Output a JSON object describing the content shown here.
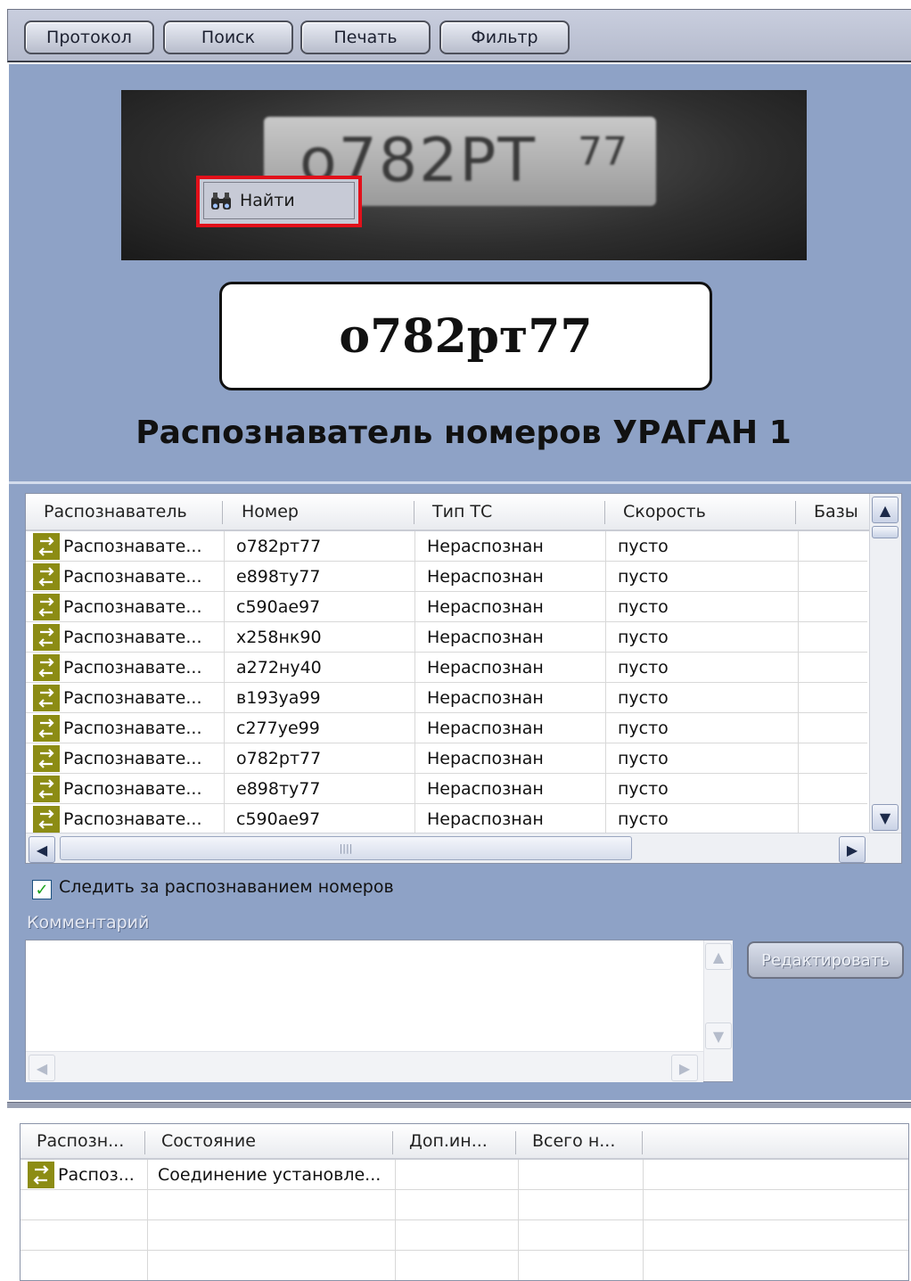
{
  "toolbar": {
    "buttons": [
      "Протокол",
      "Поиск",
      "Печать",
      "Фильтр"
    ]
  },
  "context_menu": {
    "find_label": "Найти",
    "icon": "binoculars-icon"
  },
  "plate_photo": {
    "plate_text": "о782РТ",
    "region": "77"
  },
  "recognized_number": "о782рт77",
  "recognizer_title": "Распознаватель номеров УРАГАН 1",
  "list": {
    "columns": [
      "Распознаватель",
      "Номер",
      "Тип ТС",
      "Скорость",
      "Базы"
    ],
    "rows": [
      {
        "recognizer": "Распознавате...",
        "number": "о782рт77",
        "type": "Нераспознан",
        "speed": "пусто"
      },
      {
        "recognizer": "Распознавате...",
        "number": "е898ту77",
        "type": "Нераспознан",
        "speed": "пусто"
      },
      {
        "recognizer": "Распознавате...",
        "number": "с590ае97",
        "type": "Нераспознан",
        "speed": "пусто"
      },
      {
        "recognizer": "Распознавате...",
        "number": "х258нк90",
        "type": "Нераспознан",
        "speed": "пусто"
      },
      {
        "recognizer": "Распознавате...",
        "number": "а272ну40",
        "type": "Нераспознан",
        "speed": "пусто"
      },
      {
        "recognizer": "Распознавате...",
        "number": "в193уа99",
        "type": "Нераспознан",
        "speed": "пусто"
      },
      {
        "recognizer": "Распознавате...",
        "number": "с277уе99",
        "type": "Нераспознан",
        "speed": "пусто"
      },
      {
        "recognizer": "Распознавате...",
        "number": "о782рт77",
        "type": "Нераспознан",
        "speed": "пусто"
      },
      {
        "recognizer": "Распознавате...",
        "number": "е898ту77",
        "type": "Нераспознан",
        "speed": "пусто"
      },
      {
        "recognizer": "Распознавате...",
        "number": "с590ае97",
        "type": "Нераспознан",
        "speed": "пусто"
      }
    ]
  },
  "watch_checkbox": {
    "label": "Следить за распознаванием номеров",
    "checked": true
  },
  "comment": {
    "label": "Комментарий",
    "value": "",
    "edit_button": "Редактировать"
  },
  "status_table": {
    "columns": [
      "Распозн...",
      "Состояние",
      "Доп.ин...",
      "Всего н..."
    ],
    "rows": [
      {
        "recognizer": "Распоз...",
        "state": "Соединение установле..."
      }
    ]
  },
  "colors": {
    "panel_bg": "#8ea2c6",
    "highlight": "#e2101a",
    "row_icon": "#8c8c14"
  }
}
